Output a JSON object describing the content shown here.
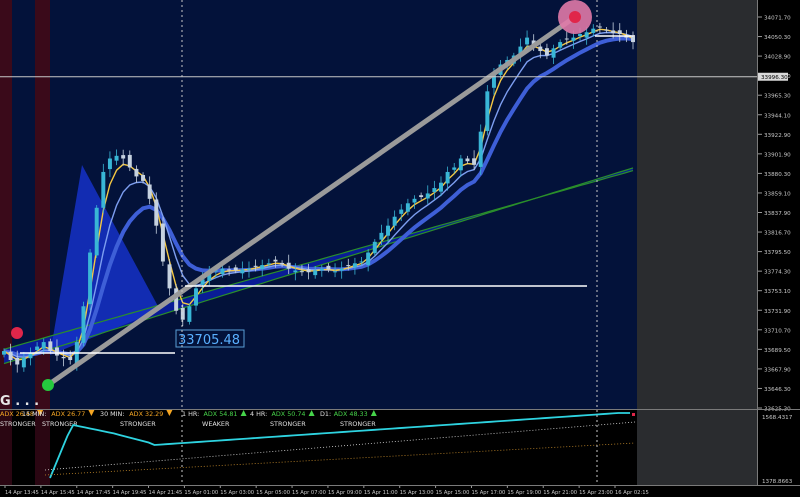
{
  "chart_data": {
    "type": "candlestick",
    "main": {
      "price_axis_labels": [
        "34071.70",
        "34050.30",
        "34028.90",
        "33986.50",
        "33965.30",
        "33944.10",
        "33922.90",
        "33901.90",
        "33880.30",
        "33859.10",
        "33837.90",
        "33816.70",
        "33795.50",
        "33774.30",
        "33753.10",
        "33731.90",
        "33710.70",
        "33689.50",
        "33667.90",
        "33646.30",
        "33625.30"
      ],
      "current_price": "33996.30",
      "ylim": [
        33625.3,
        34082
      ],
      "close_series": [
        33690,
        33680,
        33675,
        33682,
        33688,
        33695,
        33700,
        33690,
        33685,
        33682,
        33680,
        33700,
        33740,
        33800,
        33850,
        33890,
        33905,
        33908,
        33905,
        33895,
        33885,
        33880,
        33860,
        33830,
        33790,
        33760,
        33735,
        33725,
        33740,
        33760,
        33770,
        33778,
        33780,
        33782,
        33781,
        33780,
        33781,
        33782,
        33784,
        33786,
        33788,
        33790,
        33787,
        33782,
        33780,
        33779,
        33778,
        33780,
        33782,
        33781,
        33779,
        33782,
        33785,
        33788,
        33790,
        33800,
        33812,
        33822,
        33830,
        33840,
        33848,
        33855,
        33860,
        33862,
        33866,
        33872,
        33878,
        33890,
        33895,
        33905,
        33902,
        33898,
        33935,
        33980,
        34000,
        34010,
        34015,
        34020,
        34030,
        34040,
        34030,
        34025,
        34020,
        34028,
        34035,
        34038,
        34040,
        34044,
        34046,
        34050,
        34052,
        34048,
        34045,
        34044,
        34040,
        34035
      ],
      "annotation_label": "33705.48",
      "overlay_text": "G . . ."
    },
    "indicator": {
      "axis_labels": [
        "1568.4317",
        "1378.8663"
      ],
      "adx_items": [
        {
          "tf": "",
          "value": "ADX 26.48",
          "arrow": "down",
          "status": "STRONGER",
          "color": "#f5a623"
        },
        {
          "tf": "15 MIN:",
          "value": "ADX 26.77",
          "arrow": "down",
          "status": "STRONGER",
          "color": "#f5a623"
        },
        {
          "tf": "30 MIN:",
          "value": "ADX 32.29",
          "arrow": "down",
          "status": "STRONGER",
          "color": "#f5a623"
        },
        {
          "tf": "1 HR:",
          "value": "ADX 54.81",
          "arrow": "up",
          "status": "WEAKER",
          "color": "#46d44a"
        },
        {
          "tf": "4 HR:",
          "value": "ADX 50.74",
          "arrow": "up",
          "status": "STRONGER",
          "color": "#46d44a"
        },
        {
          "tf": "D1:",
          "value": "ADX 48.33",
          "arrow": "up",
          "status": "STRONGER",
          "color": "#46d44a"
        }
      ]
    },
    "time_axis_labels": [
      "14 Apr 13:45",
      "14 Apr 15:45",
      "14 Apr 17:45",
      "14 Apr 19:45",
      "14 Apr 21:45",
      "15 Apr 01:00",
      "15 Apr 03:00",
      "15 Apr 05:00",
      "15 Apr 07:00",
      "15 Apr 09:00",
      "15 Apr 11:00",
      "15 Apr 13:00",
      "15 Apr 15:00",
      "15 Apr 17:00",
      "15 Apr 19:00",
      "15 Apr 21:00",
      "15 Apr 23:00",
      "16 Apr 02:15"
    ],
    "colors": {
      "background": "#03123a",
      "bull_candle": "#39b6d6",
      "bear_candle": "#c6d2e0",
      "channel_fill": "#0a1d9b",
      "fast_ma": "#f5c842",
      "mid_ma": "#7d9ef0",
      "slow_ma": "#3e5fd7",
      "long_ma": "#2a8f2a",
      "trend_line": "#9a9a9a",
      "adx_line": "#2ed3e0",
      "marker_red": "#e0264a",
      "marker_green": "#25c93e"
    }
  }
}
